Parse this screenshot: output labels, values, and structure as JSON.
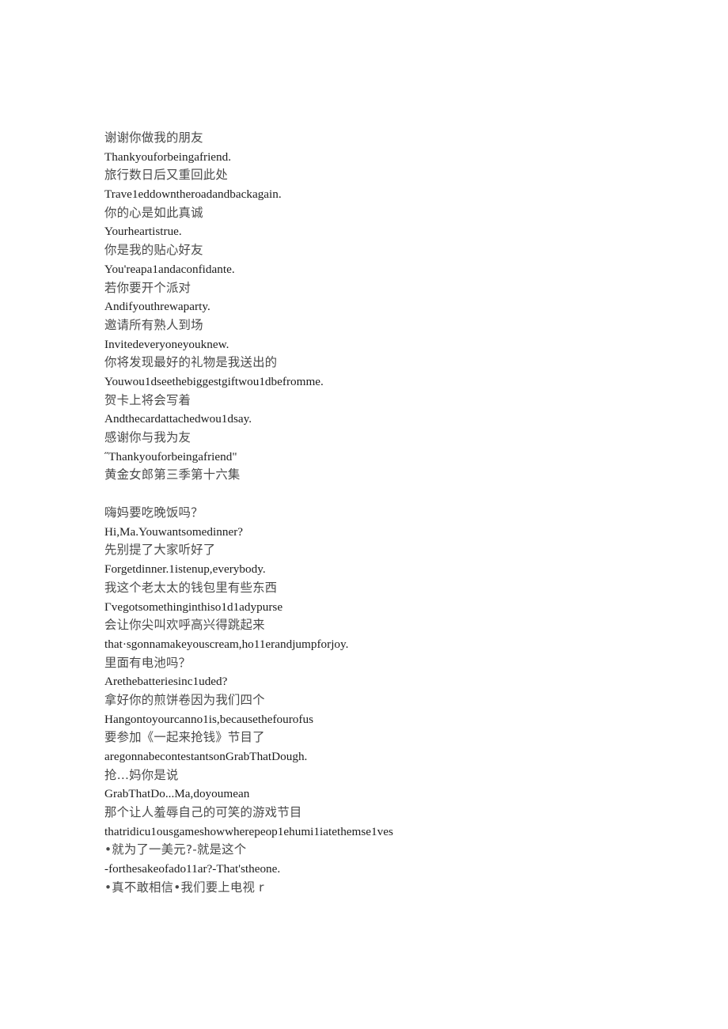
{
  "document": {
    "page_background": "#ffffff",
    "text_color_source": "#4a4a4a",
    "text_color_latin": "#1c1c1c",
    "blocks": [
      {
        "id": "block-1",
        "lines": [
          {
            "script": "zh",
            "text": "谢谢你做我的朋友"
          },
          {
            "script": "en",
            "text": "Thankyouforbeingafriend."
          },
          {
            "script": "zh",
            "text": "旅行数日后又重回此处"
          },
          {
            "script": "en",
            "text": "Trave1eddowntheroadandbackagain."
          },
          {
            "script": "zh",
            "text": "你的心是如此真诚"
          },
          {
            "script": "en",
            "text": "Yourheartistrue."
          },
          {
            "script": "zh",
            "text": "你是我的贴心好友"
          },
          {
            "script": "en",
            "text": "You'reapa1andaconfidante."
          },
          {
            "script": "zh",
            "text": "若你要开个派对"
          },
          {
            "script": "en",
            "text": "Andifyouthrewaparty."
          },
          {
            "script": "zh",
            "text": "邀请所有熟人到场"
          },
          {
            "script": "en",
            "text": "Invitedeveryoneyouknew."
          },
          {
            "script": "zh",
            "text": "你将发现最好的礼物是我送出的"
          },
          {
            "script": "en",
            "text": "Youwou1dseethebiggestgiftwou1dbefromme."
          },
          {
            "script": "zh",
            "text": "贺卡上将会写着"
          },
          {
            "script": "en",
            "text": "Andthecardattachedwou1dsay."
          },
          {
            "script": "zh",
            "text": "感谢你与我为友"
          },
          {
            "script": "en",
            "text": "˝Thankyouforbeingafriend\""
          },
          {
            "script": "zh",
            "text": "黄金女郎第三季第十六集"
          }
        ]
      },
      {
        "id": "block-2",
        "lines": [
          {
            "script": "zh",
            "text": "嗨妈要吃晚饭吗？"
          },
          {
            "script": "en",
            "text": "Hi,Ma.Youwantsomedinner?"
          },
          {
            "script": "zh",
            "text": "先别提了大家听好了"
          },
          {
            "script": "en",
            "text": "Forgetdinner.1istenup,everybody."
          },
          {
            "script": "zh",
            "text": "我这个老太太的钱包里有些东西"
          },
          {
            "script": "en",
            "text": "Γvegotsomethinginthiso1d1adypurse"
          },
          {
            "script": "zh",
            "text": "会让你尖叫欢呼高兴得跳起来"
          },
          {
            "script": "en",
            "text": "that·sgonnamakeyouscream,ho11erandjumpforjoy."
          },
          {
            "script": "zh",
            "text": "里面有电池吗？"
          },
          {
            "script": "en",
            "text": "Arethebatteriesinc1uded?"
          },
          {
            "script": "zh",
            "text": "拿好你的煎饼卷因为我们四个"
          },
          {
            "script": "en",
            "text": "Hangontoyourcanno1is,becausethefourofus"
          },
          {
            "script": "zh",
            "text": "要参加《一起来抢钱》节目了"
          },
          {
            "script": "en",
            "text": "aregonnabecontestantsonGrabThatDough."
          },
          {
            "script": "zh",
            "text": "抢…妈你是说"
          },
          {
            "script": "en",
            "text": "GrabThatDo...Ma,doyoumean"
          },
          {
            "script": "zh",
            "text": "那个让人羞辱自己的可笑的游戏节目"
          },
          {
            "script": "en",
            "text": "thatridicu1ousgameshowwherepeop1ehumi1iatethemse1ves"
          },
          {
            "script": "zh",
            "text": "•就为了一美元?-就是这个"
          },
          {
            "script": "en",
            "text": "-forthesakeofado11ar?-That'stheone."
          },
          {
            "script": "zh",
            "text": "•真不敢相信•我们要上电视 r"
          }
        ]
      }
    ]
  }
}
